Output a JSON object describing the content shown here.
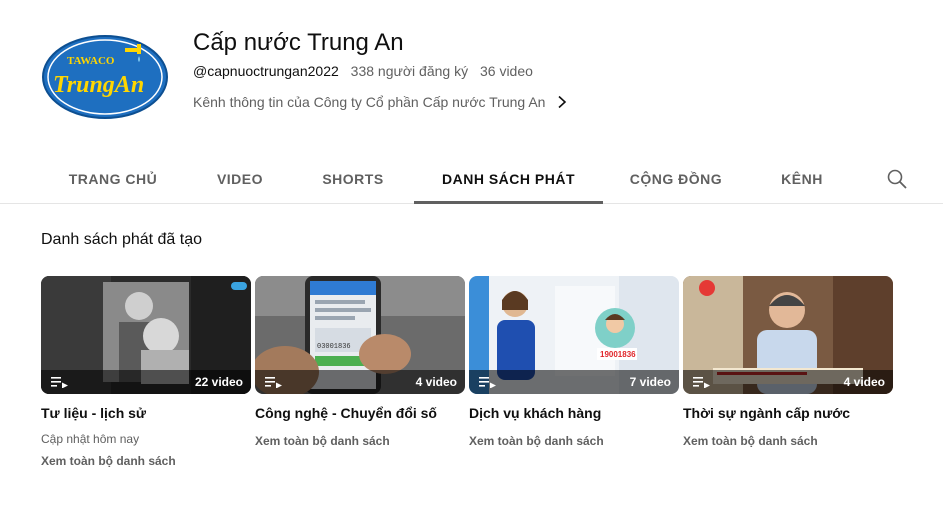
{
  "channel": {
    "logo_text_top": "TAWACO",
    "logo_text_main": "TrungAn",
    "title": "Cấp nước Trung An",
    "handle": "@capnuoctrungan2022",
    "subscribers": "338 người đăng ký",
    "video_count": "36 video",
    "description": "Kênh thông tin của Công ty Cổ phần Cấp nước Trung An"
  },
  "tabs": [
    {
      "label": "TRANG CHỦ",
      "active": false
    },
    {
      "label": "VIDEO",
      "active": false
    },
    {
      "label": "SHORTS",
      "active": false
    },
    {
      "label": "DANH SÁCH PHÁT",
      "active": true
    },
    {
      "label": "CỘNG ĐỒNG",
      "active": false
    },
    {
      "label": "KÊNH",
      "active": false
    }
  ],
  "section": {
    "title": "Danh sách phát đã tạo"
  },
  "playlists": [
    {
      "title": "Tư liệu - lịch sử",
      "count": "22 video",
      "updated": "Cập nhật hôm nay",
      "link": "Xem toàn bộ danh sách"
    },
    {
      "title": "Công nghệ - Chuyển đổi số",
      "count": "4 video",
      "link": "Xem toàn bộ danh sách",
      "thumb_text": "03001836"
    },
    {
      "title": "Dịch vụ khách hàng",
      "count": "7 video",
      "link": "Xem toàn bộ danh sách",
      "thumb_text": "19001836"
    },
    {
      "title": "Thời sự ngành cấp nước",
      "count": "4 video",
      "link": "Xem toàn bộ danh sách"
    }
  ],
  "icons": {
    "search": "search-icon",
    "chevron": "chevron-right-icon",
    "playlist": "playlist-icon"
  },
  "colors": {
    "text_primary": "#0f0f0f",
    "text_secondary": "#606060",
    "logo_blue": "#1e73be",
    "logo_yellow": "#ffd600"
  }
}
